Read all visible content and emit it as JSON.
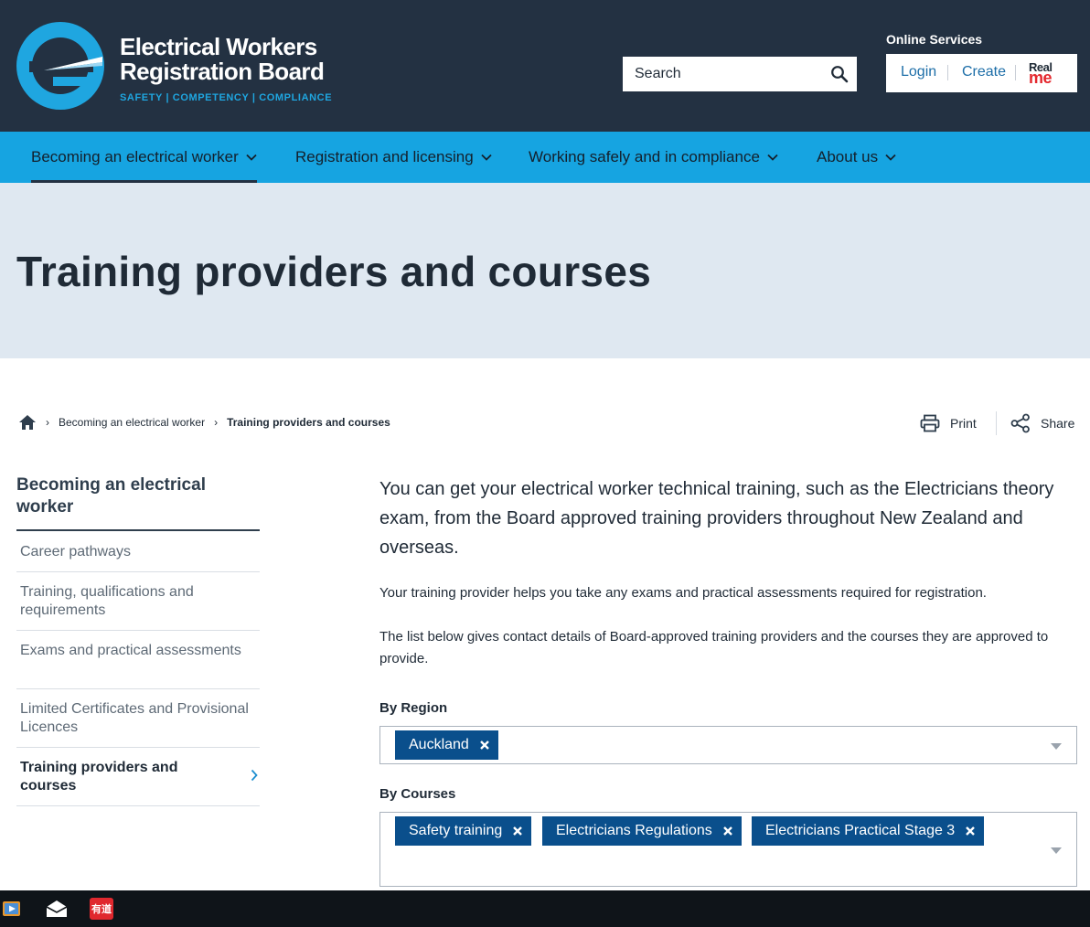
{
  "header": {
    "org_name_line1": "Electrical Workers",
    "org_name_line2": "Registration Board",
    "tagline": "SAFETY | COMPETENCY | COMPLIANCE",
    "search": {
      "placeholder": "Search"
    },
    "online_services": {
      "label": "Online Services",
      "login": "Login",
      "create": "Create",
      "realme_line1": "Real",
      "realme_line2": "me"
    }
  },
  "nav": {
    "items": [
      {
        "label": "Becoming an electrical worker"
      },
      {
        "label": "Registration and licensing"
      },
      {
        "label": "Working safely and in compliance"
      },
      {
        "label": "About us"
      }
    ]
  },
  "page": {
    "title": "Training providers and courses"
  },
  "breadcrumb": {
    "items": [
      "Becoming an electrical worker",
      "Training providers and courses"
    ]
  },
  "tools": {
    "print": "Print",
    "share": "Share"
  },
  "sidebar": {
    "title": "Becoming an electrical worker",
    "items": [
      {
        "label": "Career pathways"
      },
      {
        "label": "Training, qualifications and requirements"
      },
      {
        "label": "Exams and practical assessments"
      },
      {
        "label": "Limited Certificates and Provisional Licences"
      },
      {
        "label": "Training providers and courses"
      }
    ]
  },
  "content": {
    "lead": "You can get your electrical worker technical training, such as the Electricians theory exam, from the Board approved training providers throughout New Zealand and overseas.",
    "para1": "Your training provider helps you take any exams and practical assessments required for registration.",
    "para2": "The list below gives contact details of Board-approved training providers and the courses they are approved to provide."
  },
  "filters": {
    "region": {
      "label": "By Region",
      "selected": [
        "Auckland"
      ]
    },
    "courses": {
      "label": "By Courses",
      "selected": [
        "Safety training",
        "Electricians Regulations",
        "Electricians Practical Stage 3"
      ]
    }
  },
  "taskbar": {
    "icons": [
      "media-player-icon",
      "mail-icon",
      "youdao-dictionary-icon"
    ],
    "youdao_label": "有道"
  },
  "colors": {
    "header_bg": "#233142",
    "nav_bg": "#16a4e1",
    "banner_bg": "#dfe8f1",
    "tag_bg": "#0a4f8c",
    "link": "#1d6ea8",
    "accent_blue": "#1fa6e0"
  }
}
